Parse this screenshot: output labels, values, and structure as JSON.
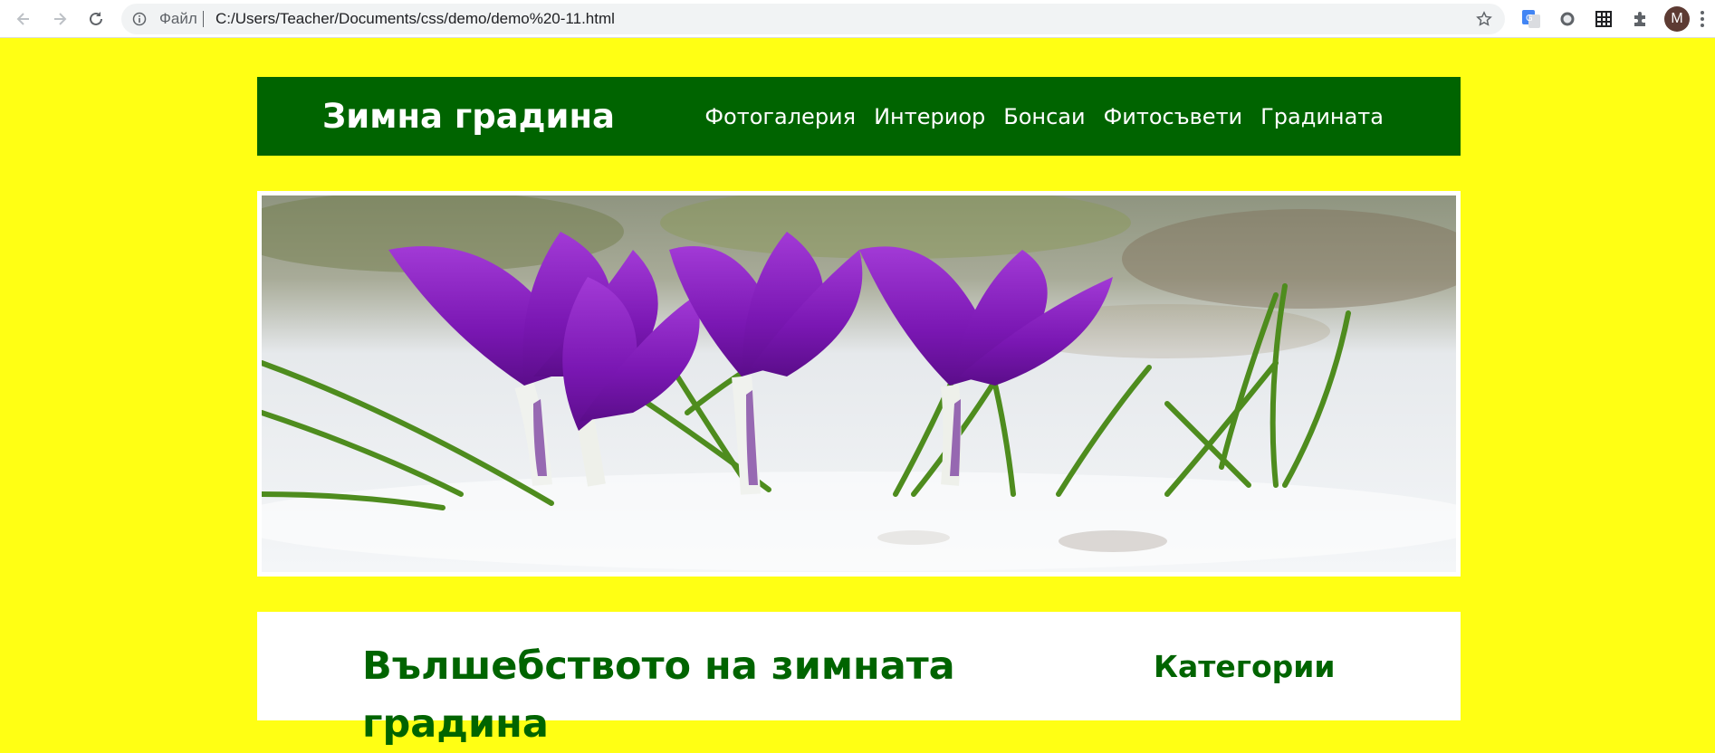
{
  "browser": {
    "scheme_label": "Файл",
    "url": "C:/Users/Teacher/Documents/css/demo/demo%20-11.html",
    "profile_initial": "M"
  },
  "site": {
    "title": "Зимна градина",
    "nav": [
      "Фотогалерия",
      "Интериор",
      "Бонсаи",
      "Фитосъвети",
      "Градината"
    ],
    "hero_alt": "purple crocus flowers in snow",
    "colors": {
      "background": "#ffff14",
      "header": "#006400",
      "heading": "#006400"
    }
  },
  "main": {
    "heading": "Вълшебството на зимната градина",
    "sidebar_heading": "Категории"
  }
}
